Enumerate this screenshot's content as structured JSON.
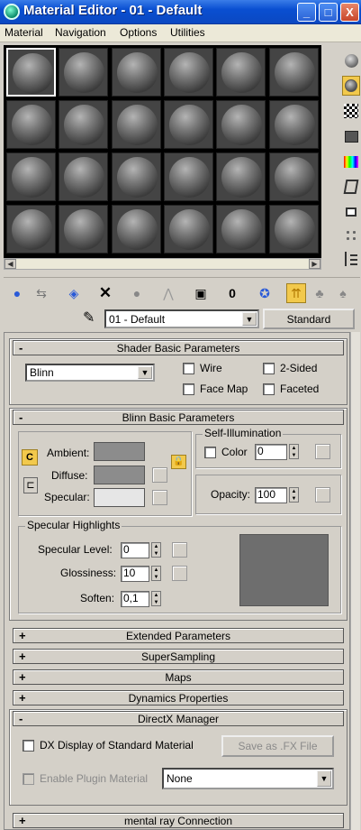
{
  "window": {
    "title": "Material Editor - 01 - Default",
    "min": "_",
    "max": "□",
    "close": "X"
  },
  "menu": [
    "Material",
    "Navigation",
    "Options",
    "Utilities"
  ],
  "material": {
    "name": "01 - Default",
    "type_button": "Standard"
  },
  "shader": {
    "title": "Shader Basic Parameters",
    "collapse": "-",
    "shader_value": "Blinn",
    "wire": "Wire",
    "two_sided": "2-Sided",
    "face_map": "Face Map",
    "faceted": "Faceted"
  },
  "blinn": {
    "title": "Blinn Basic Parameters",
    "collapse": "-",
    "ambient": "Ambient:",
    "diffuse": "Diffuse:",
    "specular": "Specular:",
    "self_illum_title": "Self-Illumination",
    "color_label": "Color",
    "color_value": "0",
    "opacity_label": "Opacity:",
    "opacity_value": "100",
    "lock_c": "C",
    "colors": {
      "ambient": "#8c8c8c",
      "diffuse": "#8c8c8c",
      "specular": "#e6e6e6",
      "preview": "#6e6e6e"
    }
  },
  "specular_highlights": {
    "title": "Specular Highlights",
    "level_label": "Specular Level:",
    "level_value": "0",
    "gloss_label": "Glossiness:",
    "gloss_value": "10",
    "soften_label": "Soften:",
    "soften_value": "0,1"
  },
  "rollouts": [
    {
      "sign": "+",
      "title": "Extended Parameters"
    },
    {
      "sign": "+",
      "title": "SuperSampling"
    },
    {
      "sign": "+",
      "title": "Maps"
    },
    {
      "sign": "+",
      "title": "Dynamics Properties"
    }
  ],
  "directx": {
    "sign": "-",
    "title": "DirectX Manager",
    "dx_display": "DX Display of Standard Material",
    "save_fx": "Save as .FX File",
    "enable_plugin": "Enable Plugin Material",
    "plugin_value": "None"
  },
  "mentalray": {
    "sign": "+",
    "title": "mental ray Connection"
  }
}
